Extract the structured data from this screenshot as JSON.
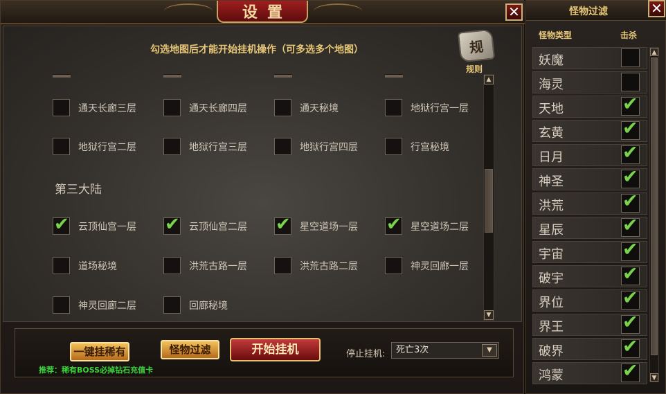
{
  "window": {
    "title": "设置",
    "close_symbol": "✕",
    "notice": "勾选地图后才能开始挂机操作（可多选多个地图）",
    "rules_icon_glyph": "规",
    "rules_label": "规则"
  },
  "maps": {
    "row1": [
      {
        "label": "通天长廊三层",
        "checked": false
      },
      {
        "label": "通天长廊四层",
        "checked": false
      },
      {
        "label": "通天秘境",
        "checked": false
      },
      {
        "label": "地狱行宫一层",
        "checked": false
      }
    ],
    "row2": [
      {
        "label": "地狱行宫二层",
        "checked": false
      },
      {
        "label": "地狱行宫三层",
        "checked": false
      },
      {
        "label": "地狱行宫四层",
        "checked": false
      },
      {
        "label": "行宫秘境",
        "checked": false
      }
    ],
    "section3_title": "第三大陆",
    "row3": [
      {
        "label": "云顶仙宫一层",
        "checked": true
      },
      {
        "label": "云顶仙宫二层",
        "checked": true
      },
      {
        "label": "星空道场一层",
        "checked": true
      },
      {
        "label": "星空道场二层",
        "checked": true
      }
    ],
    "row4": [
      {
        "label": "道场秘境",
        "checked": false
      },
      {
        "label": "洪荒古路一层",
        "checked": false
      },
      {
        "label": "洪荒古路二层",
        "checked": false
      },
      {
        "label": "神灵回廊一层",
        "checked": false
      }
    ],
    "row5": [
      {
        "label": "神灵回廊二层",
        "checked": false
      },
      {
        "label": "回廊秘境",
        "checked": false
      }
    ]
  },
  "scroll": {
    "up": "▲",
    "down": "▼"
  },
  "bottom": {
    "rare_button": "一键挂稀有",
    "filter_button": "怪物过滤",
    "start_button": "开始挂机",
    "stop_label": "停止挂机:",
    "stop_value": "死亡3次",
    "dropdown_arrow": "▼",
    "tip": "推荐：稀有BOSS必掉钻石充值卡"
  },
  "filter": {
    "title": "怪物过滤",
    "col_type": "怪物类型",
    "col_kill": "击杀",
    "monsters": [
      {
        "name": "妖魔",
        "kill": false
      },
      {
        "name": "海灵",
        "kill": false
      },
      {
        "name": "天地",
        "kill": true
      },
      {
        "name": "玄黄",
        "kill": true
      },
      {
        "name": "日月",
        "kill": true
      },
      {
        "name": "神圣",
        "kill": true
      },
      {
        "name": "洪荒",
        "kill": true
      },
      {
        "name": "星辰",
        "kill": true
      },
      {
        "name": "宇宙",
        "kill": true
      },
      {
        "name": "破宇",
        "kill": true
      },
      {
        "name": "界位",
        "kill": true
      },
      {
        "name": "界王",
        "kill": true
      },
      {
        "name": "破界",
        "kill": true
      },
      {
        "name": "鸿蒙",
        "kill": true
      }
    ]
  },
  "colors": {
    "accent_gold": "#e7c878",
    "tick_green": "#7cd24e",
    "tip_green": "#3bd43b",
    "title_red": "#a01e1e"
  }
}
